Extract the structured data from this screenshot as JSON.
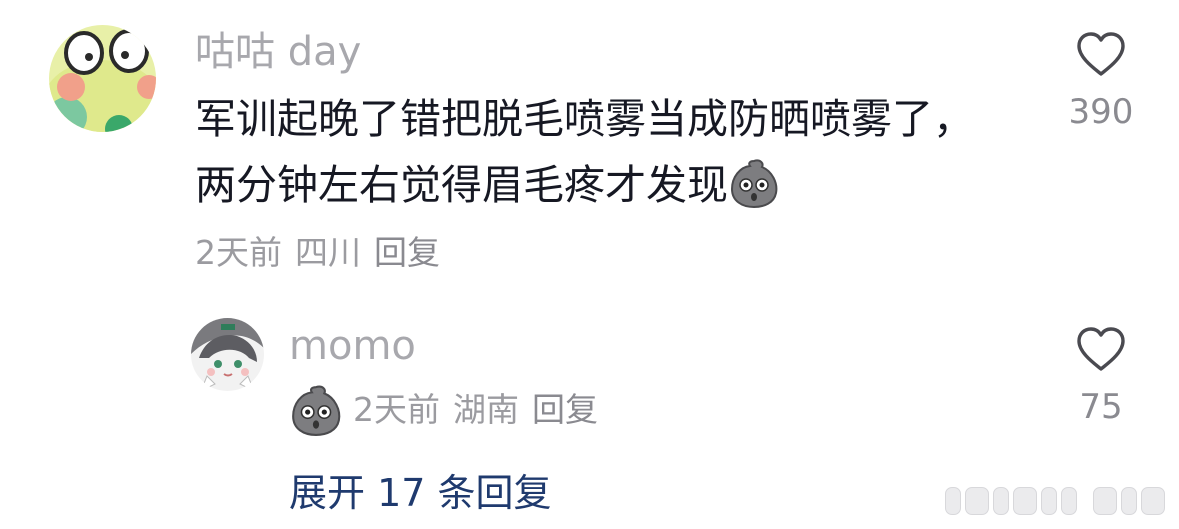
{
  "comment": {
    "username": "咕咕 day",
    "text_line1": "军训起晚了错把脱毛喷雾当成防晒喷雾了，",
    "text_line2": "两分钟左右觉得眉毛疼才发现",
    "emoji_icon": "blob-face-icon",
    "time": "2天前",
    "location": "四川",
    "reply_label": "回复",
    "like_count": "390"
  },
  "reply": {
    "username": "momo",
    "emoji_icon": "blob-face-icon",
    "time": "2天前",
    "location": "湖南",
    "reply_label": "回复",
    "like_count": "75"
  },
  "expand_replies": {
    "label": "展开 17 条回复"
  },
  "colors": {
    "username": "#a8a8ad",
    "text": "#161823",
    "meta": "#9b9ba0",
    "link": "#1f3a6e"
  }
}
